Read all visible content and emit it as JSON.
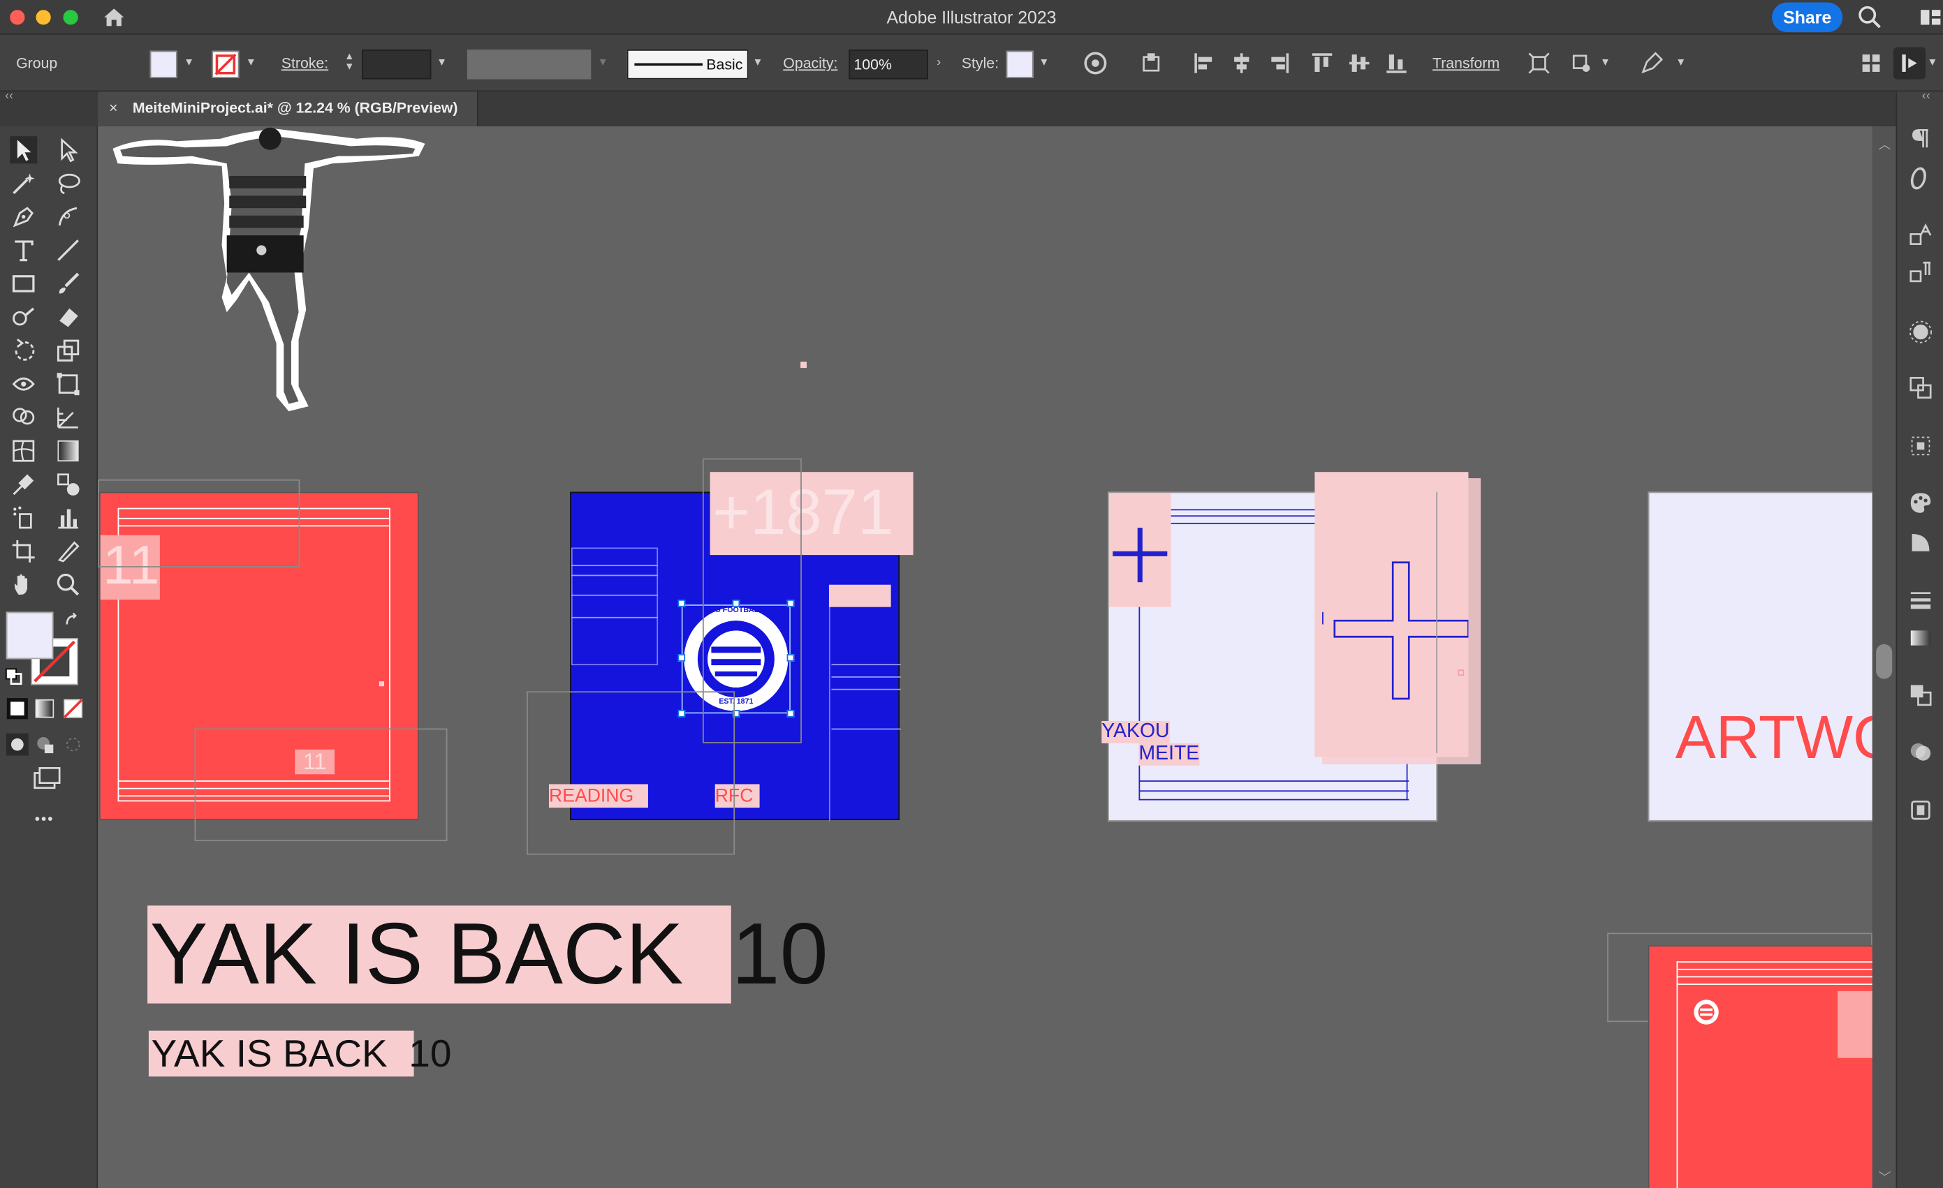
{
  "window": {
    "app_title": "Adobe Illustrator 2023",
    "share_label": "Share"
  },
  "control_bar": {
    "selection_type": "Group",
    "stroke_label": "Stroke:",
    "brush_label": "Basic",
    "opacity_label": "Opacity:",
    "opacity_value": "100%",
    "style_label": "Style:",
    "transform_label": "Transform"
  },
  "document_tab": {
    "title": "MeiteMiniProject.ai* @ 12.24 % (RGB/Preview)",
    "close_label": "×"
  },
  "artboards": {
    "artboard1": {
      "number_top": "11",
      "number_bottom": "11"
    },
    "artboard2": {
      "est_text": "+1871",
      "reading_label": "READING",
      "rfc_label": "RFC",
      "crest_ring_text": "READING FOOTBALL CLUB",
      "crest_est": "EST. 1871"
    },
    "artboard3": {
      "first_name": "YAKOU",
      "last_name": "MEITE"
    },
    "artboard4": {
      "title": "ARTWO"
    }
  },
  "headline": {
    "large": "YAK IS BACK  10",
    "small": "YAK IS BACK  10"
  },
  "toolbox": {
    "more_label": "•••"
  },
  "colors": {
    "red_artboard": "#ff4b4b",
    "blue_artboard": "#1414dc",
    "pink_block": "#f8cdd0",
    "lavender_artboard": "#ecebfb",
    "share_blue": "#1473e6"
  }
}
